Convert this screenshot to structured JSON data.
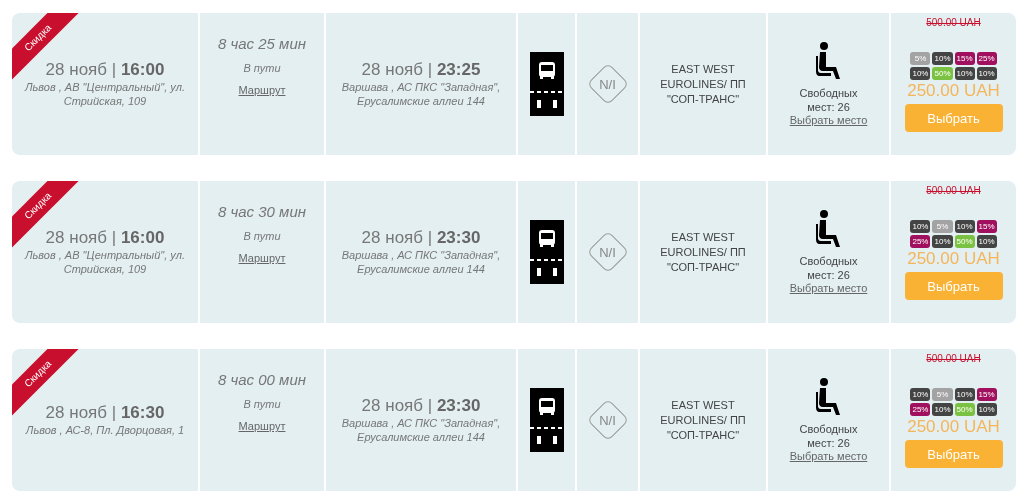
{
  "trips": [
    {
      "discount": true,
      "ribbon": "Скидка",
      "departure": {
        "when": "28 нояб | **16:00**",
        "place": "Львов , АВ \"Центральный\", ул. Стрийская, 109"
      },
      "duration": "8 час 25 мин",
      "duration_label": "В пути",
      "route_link": "Маршрут",
      "arrival": {
        "when": "28 нояб | **23:25**",
        "place": "Варшава , АС ПКС \"Западная\", Ерусалимские аллеи 144"
      },
      "class_badge": "N/I",
      "carrier": "EAST WEST EUROLINES/ ПП \"СОП-ТРАНС\"",
      "seats": "Свободных мест: 26",
      "seat_link": "Выбрать место",
      "old_price": "500.00 UAH",
      "discounts": [
        {
          "label": "5%",
          "color": "#a3a3a3"
        },
        {
          "label": "10%",
          "color": "#444444"
        },
        {
          "label": "15%",
          "color": "#a0105e"
        },
        {
          "label": "25%",
          "color": "#a0105e"
        },
        {
          "label": "10%",
          "color": "#444444"
        },
        {
          "label": "50%",
          "color": "#7cc242"
        },
        {
          "label": "10%",
          "color": "#444444"
        },
        {
          "label": "10%",
          "color": "#444444"
        }
      ],
      "price": "250.00 UAH",
      "button": "Выбрать"
    },
    {
      "discount": true,
      "ribbon": "Скидка",
      "departure": {
        "when": "28 нояб | **16:00**",
        "place": "Львов , АВ \"Центральный\", ул. Стрийская, 109"
      },
      "duration": "8 час 30 мин",
      "duration_label": "В пути",
      "route_link": "Маршрут",
      "arrival": {
        "when": "28 нояб | **23:30**",
        "place": "Варшава , АС ПКС \"Западная\", Ерусалимские аллеи 144"
      },
      "class_badge": "N/I",
      "carrier": "EAST WEST EUROLINES/ ПП \"СОП-ТРАНС\"",
      "seats": "Свободных мест: 26",
      "seat_link": "Выбрать место",
      "old_price": "500.00 UAH",
      "discounts": [
        {
          "label": "10%",
          "color": "#444444"
        },
        {
          "label": "5%",
          "color": "#a3a3a3"
        },
        {
          "label": "10%",
          "color": "#444444"
        },
        {
          "label": "15%",
          "color": "#a0105e"
        },
        {
          "label": "25%",
          "color": "#a0105e"
        },
        {
          "label": "10%",
          "color": "#444444"
        },
        {
          "label": "50%",
          "color": "#7cc242"
        },
        {
          "label": "10%",
          "color": "#444444"
        }
      ],
      "price": "250.00 UAH",
      "button": "Выбрать"
    },
    {
      "discount": true,
      "ribbon": "Скидка",
      "departure": {
        "when": "28 нояб | **16:30**",
        "place": "Львов , АС-8, Пл. Дворцовая, 1"
      },
      "duration": "8 час 00 мин",
      "duration_label": "В пути",
      "route_link": "Маршрут",
      "arrival": {
        "when": "28 нояб | **23:30**",
        "place": "Варшава , АС ПКС \"Западная\", Ерусалимские аллеи 144"
      },
      "class_badge": "N/I",
      "carrier": "EAST WEST EUROLINES/ ПП \"СОП-ТРАНС\"",
      "seats": "Свободных мест: 26",
      "seat_link": "Выбрать место",
      "old_price": "500.00 UAH",
      "discounts": [
        {
          "label": "10%",
          "color": "#444444"
        },
        {
          "label": "5%",
          "color": "#a3a3a3"
        },
        {
          "label": "10%",
          "color": "#444444"
        },
        {
          "label": "15%",
          "color": "#a0105e"
        },
        {
          "label": "25%",
          "color": "#a0105e"
        },
        {
          "label": "10%",
          "color": "#444444"
        },
        {
          "label": "50%",
          "color": "#7cc242"
        },
        {
          "label": "10%",
          "color": "#444444"
        }
      ],
      "price": "250.00 UAH",
      "button": "Выбрать"
    }
  ]
}
